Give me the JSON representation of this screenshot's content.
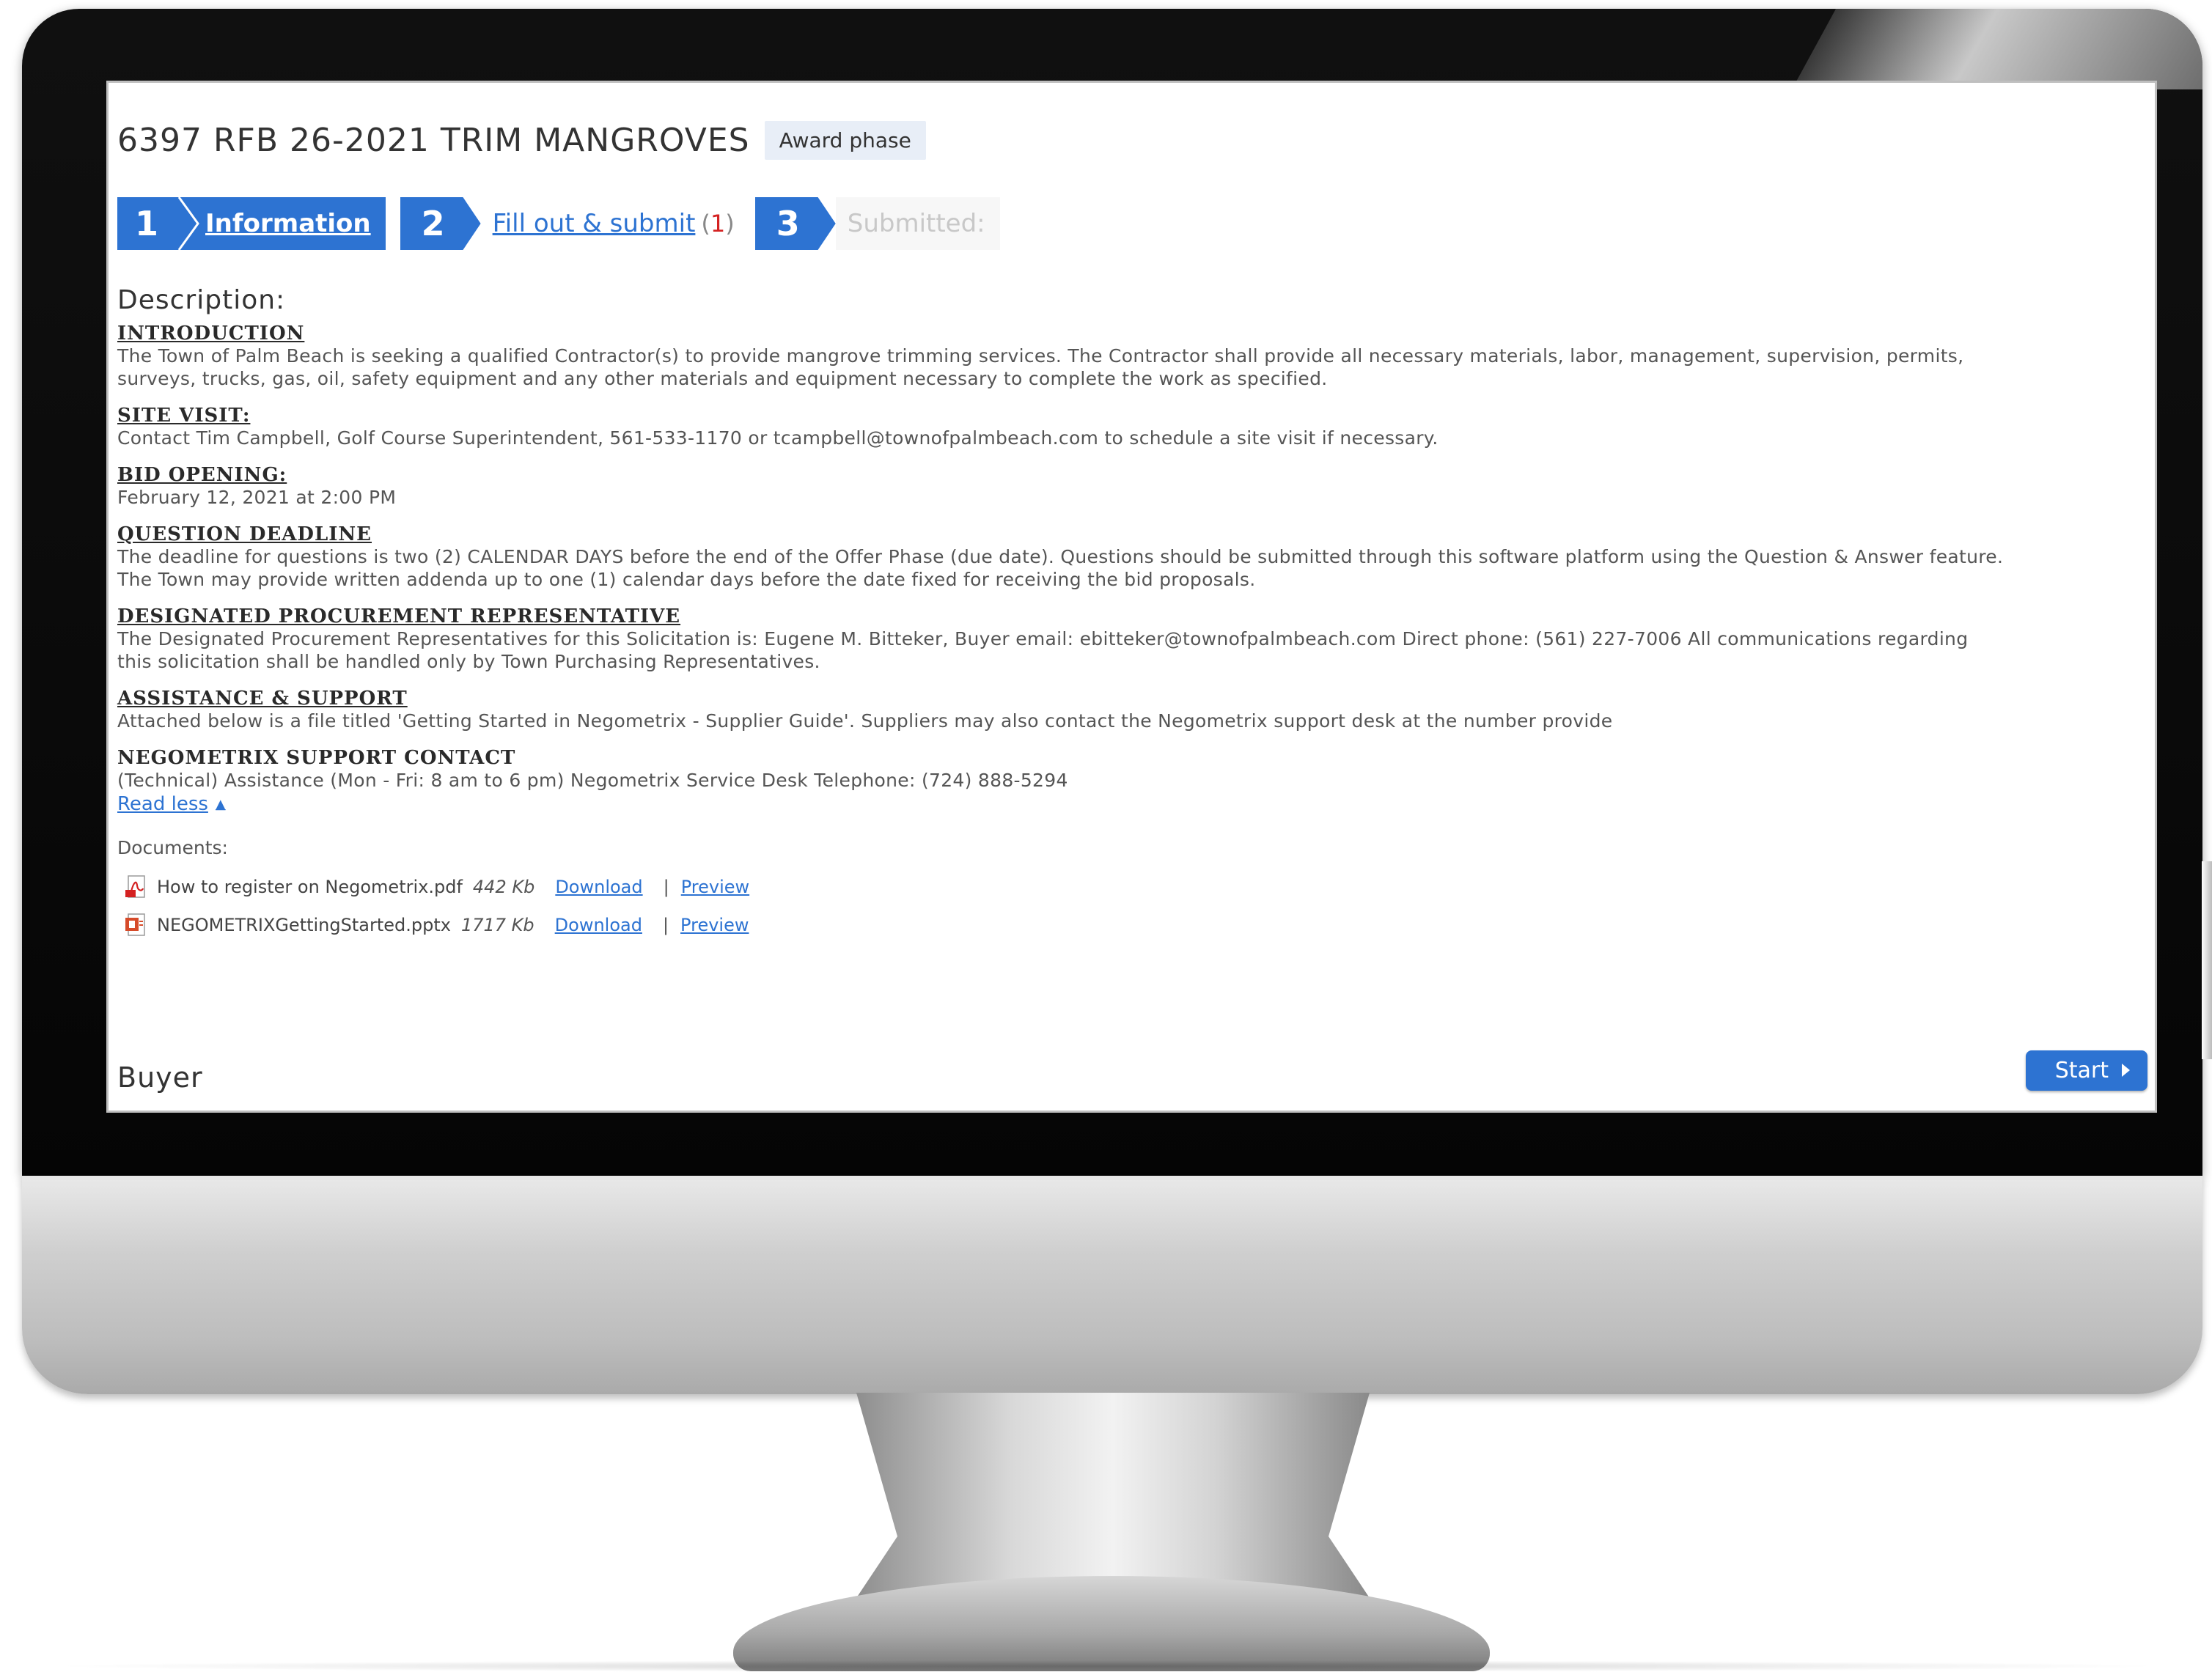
{
  "page": {
    "title": "6397 RFB 26-2021 TRIM MANGROVES",
    "phase_badge": "Award phase"
  },
  "steps": [
    {
      "number": "1",
      "label": "Information",
      "state": "active"
    },
    {
      "number": "2",
      "label": "Fill out & submit",
      "count_open": "(",
      "count": "1",
      "count_close": ")",
      "state": "link"
    },
    {
      "number": "3",
      "label": "Submitted:",
      "state": "disabled"
    }
  ],
  "description": {
    "heading": "Description:",
    "sections": [
      {
        "title": "INTRODUCTION",
        "lines": [
          "The Town of Palm Beach is seeking a qualified Contractor(s) to provide mangrove trimming services. The Contractor shall provide all necessary materials, labor, management, supervision, permits,",
          "surveys, trucks, gas, oil, safety equipment and any other materials and equipment necessary to complete the work as specified."
        ]
      },
      {
        "title": "SITE VISIT:",
        "lines": [
          "Contact Tim Campbell, Golf Course Superintendent, 561-533-1170 or tcampbell@townofpalmbeach.com to schedule a site visit if necessary."
        ]
      },
      {
        "title": "BID OPENING:",
        "lines": [
          "February 12, 2021 at 2:00 PM"
        ]
      },
      {
        "title": "QUESTION DEADLINE",
        "lines": [
          "The deadline for questions is two (2) CALENDAR DAYS before the end of the Offer Phase (due date). Questions should be submitted through this software platform using the Question & Answer feature.",
          "The Town may provide written addenda up to one (1) calendar days before the date fixed for receiving the bid proposals."
        ]
      },
      {
        "title": "DESIGNATED PROCUREMENT REPRESENTATIVE",
        "lines": [
          "The Designated Procurement Representatives for this Solicitation is: Eugene M. Bitteker, Buyer email: ebitteker@townofpalmbeach.com  Direct phone: (561) 227-7006 All communications regarding",
          "this solicitation shall be handled only by Town Purchasing Representatives."
        ]
      },
      {
        "title": "ASSISTANCE & SUPPORT",
        "lines": [
          "Attached below is a file titled 'Getting Started in Negometrix - Supplier Guide'. Suppliers may also contact the Negometrix support desk at the number provide"
        ]
      },
      {
        "title": "NEGOMETRIX SUPPORT CONTACT",
        "lines": [
          "(Technical) Assistance (Mon - Fri: 8 am to 6 pm) Negometrix Service Desk Telephone: (724) 888-5294"
        ]
      }
    ],
    "read_less": "Read less"
  },
  "documents": {
    "label": "Documents:",
    "files": [
      {
        "name": "How to register on Negometrix.pdf",
        "size": "442 Kb",
        "download": "Download",
        "separator": "|",
        "preview": "Preview",
        "icon": "pdf-file-icon"
      },
      {
        "name": "NEGOMETRIXGettingStarted.pptx",
        "size": "1717 Kb",
        "download": "Download",
        "separator": "|",
        "preview": "Preview",
        "icon": "pptx-file-icon"
      }
    ]
  },
  "buyer": {
    "heading": "Buyer"
  },
  "start_button": {
    "label": "Start"
  },
  "colors": {
    "accent": "#2d73d2",
    "badge_bg": "#e8eef7",
    "count_red": "#d42121"
  }
}
